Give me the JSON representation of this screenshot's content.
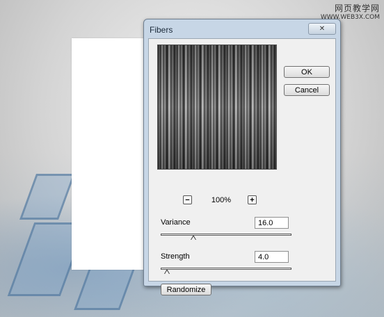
{
  "watermark": {
    "line1": "网页教学网",
    "line2": "WWW.WEB3X.COM"
  },
  "dialog": {
    "title": "Fibers",
    "close_label": "✕",
    "ok_label": "OK",
    "cancel_label": "Cancel",
    "zoom_out_label": "−",
    "zoom_in_label": "+",
    "zoom_level": "100%",
    "variance": {
      "label": "Variance",
      "value": "16.0",
      "slider_fraction": 0.25
    },
    "strength": {
      "label": "Strength",
      "value": "4.0",
      "slider_fraction": 0.05
    },
    "randomize_label": "Randomize"
  },
  "icons": {
    "close": "close-icon",
    "zoom_out": "minus-icon",
    "zoom_in": "plus-icon"
  }
}
